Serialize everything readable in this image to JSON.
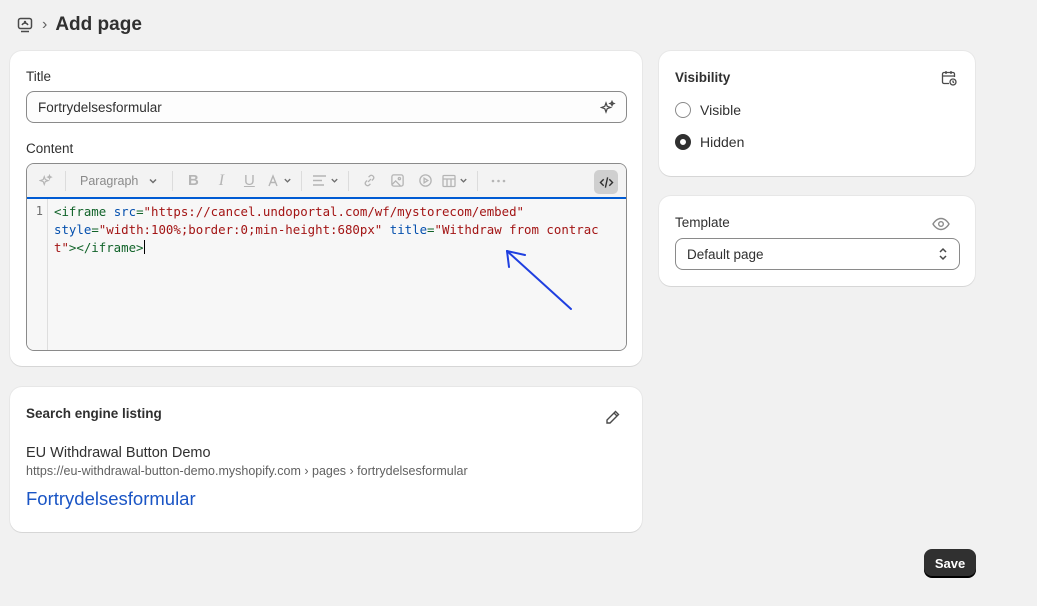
{
  "header": {
    "separator": "›",
    "title": "Add page"
  },
  "title_field": {
    "label": "Title",
    "value": "Fortrydelsesformular"
  },
  "content": {
    "label": "Content",
    "toolbar": {
      "paragraph_label": "Paragraph"
    },
    "code": {
      "line_number": "1",
      "tag_open": "<iframe",
      "src_attr": "src",
      "src_value": "\"https://cancel.undoportal.com/wf/mystorecom/embed\"",
      "style_attr": "style",
      "style_value": "\"width:100%;border:0;min-height:680px\"",
      "title_attr": "title",
      "title_value": "\"Withdraw from contract\"",
      "tag_close": "></iframe>"
    }
  },
  "seo": {
    "title": "Search engine listing",
    "store_name": "EU Withdrawal Button Demo",
    "url": "https://eu-withdrawal-button-demo.myshopify.com › pages › fortrydelsesformular",
    "page_title": "Fortrydelsesformular"
  },
  "visibility": {
    "title": "Visibility",
    "options": [
      {
        "label": "Visible",
        "checked": false
      },
      {
        "label": "Hidden",
        "checked": true
      }
    ]
  },
  "template": {
    "label": "Template",
    "selected": "Default page"
  },
  "actions": {
    "save_label": "Save"
  },
  "colors": {
    "accent": "#005bd3",
    "link": "#1a55c5",
    "annotation_arrow": "#1f3fe0",
    "primary_button": "#303030"
  },
  "icons": [
    "pages-icon",
    "ai-sparkle-icon",
    "bold-icon",
    "italic-icon",
    "underline-icon",
    "text-color-icon",
    "align-icon",
    "link-icon",
    "image-icon",
    "video-icon",
    "table-icon",
    "more-icon",
    "code-icon",
    "edit-icon",
    "calendar-clock-icon",
    "eye-icon",
    "select-chevron-icon"
  ]
}
